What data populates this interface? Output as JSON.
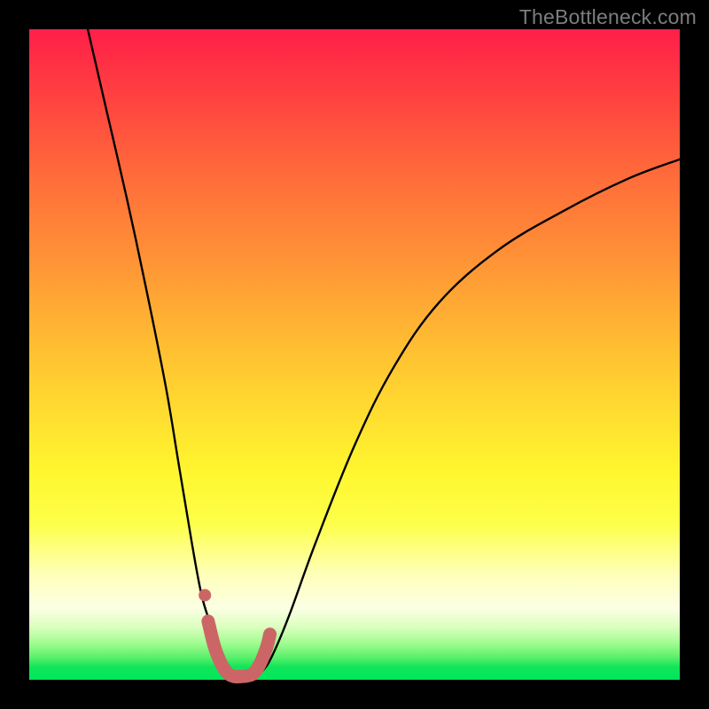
{
  "watermark": "TheBottleneck.com",
  "chart_data": {
    "type": "line",
    "title": "",
    "xlabel": "",
    "ylabel": "",
    "xlim": [
      0,
      100
    ],
    "ylim": [
      0,
      100
    ],
    "series": [
      {
        "name": "bottleneck-curve",
        "color": "#000000",
        "x": [
          9,
          12,
          15,
          18,
          21,
          23,
          25,
          26.5,
          28,
          29,
          30,
          31.5,
          33,
          34.5,
          36,
          37.5,
          40,
          44,
          50,
          56,
          63,
          72,
          82,
          92,
          100
        ],
        "y": [
          100,
          87,
          74,
          60,
          45,
          33,
          21,
          13,
          8,
          4,
          1,
          0,
          0,
          0.5,
          1.5,
          4,
          10,
          21,
          36,
          48,
          58,
          66,
          72,
          77,
          80
        ]
      },
      {
        "name": "highlight-segment",
        "color": "#cc6666",
        "x": [
          27.5,
          28.5,
          29.5,
          30.5,
          31.5,
          32.5,
          33.5,
          34.5,
          35.5,
          36.5,
          37
        ],
        "y": [
          9,
          5,
          2.5,
          1,
          0.5,
          0.5,
          0.6,
          1,
          2.5,
          5,
          7
        ]
      },
      {
        "name": "highlight-dot",
        "color": "#cc6666",
        "x": [
          27
        ],
        "y": [
          13
        ]
      }
    ]
  }
}
